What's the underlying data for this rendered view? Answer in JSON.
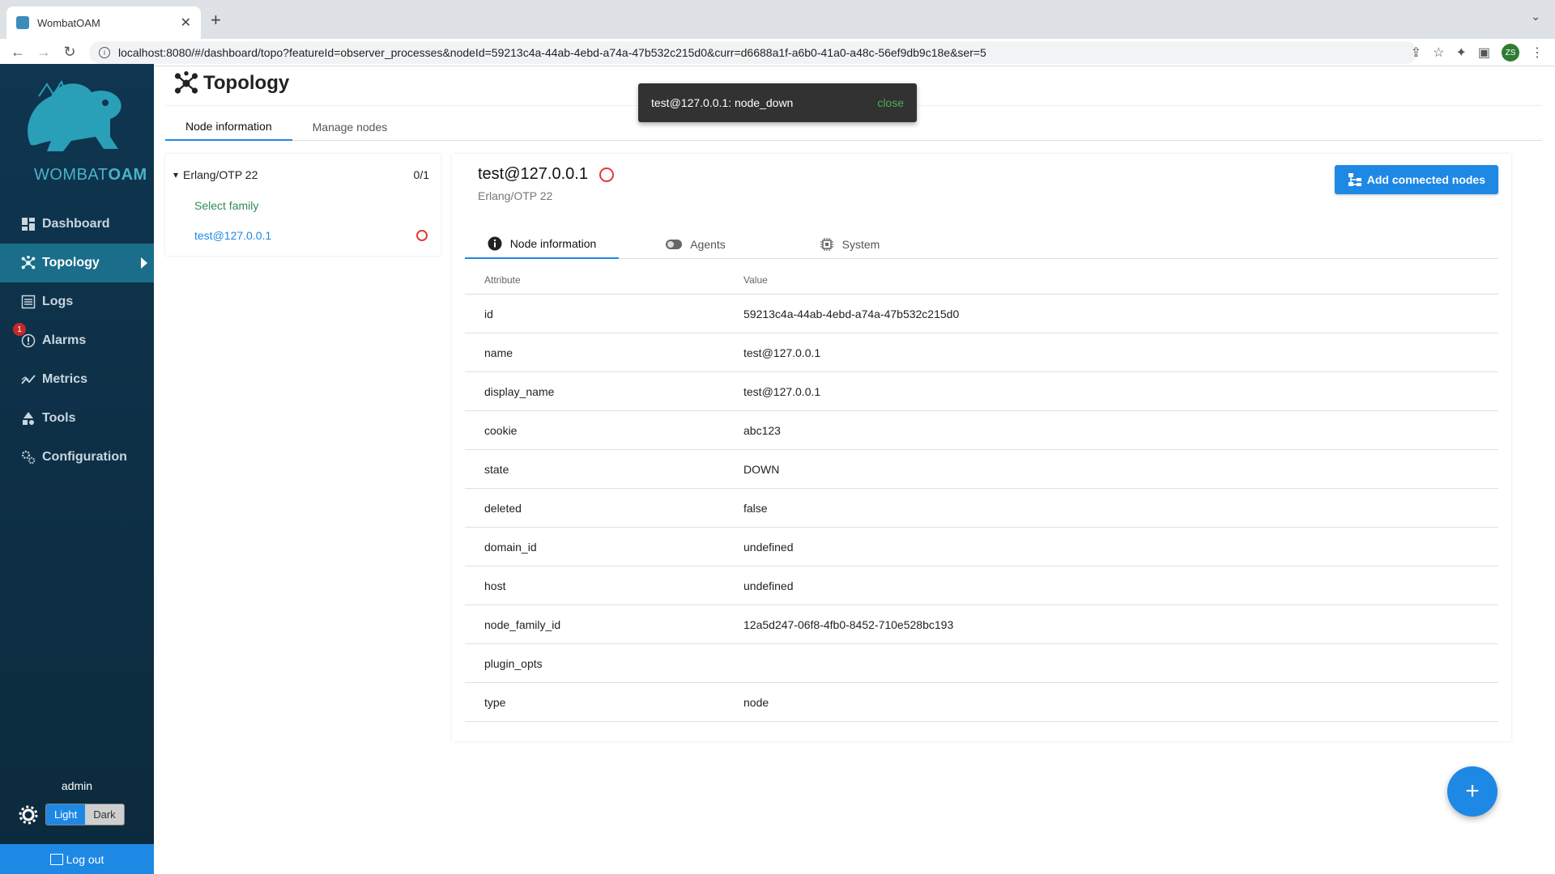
{
  "browser": {
    "tab_title": "WombatOAM",
    "url": "localhost:8080/#/dashboard/topo?featureId=observer_processes&nodeId=59213c4a-44ab-4ebd-a74a-47b532c215d0&curr=d6688a1f-a6b0-41a0-a48c-56ef9db9c18e&ser=5",
    "profile_initials": "ZS"
  },
  "sidebar": {
    "logo_text_light": "WOMBAT",
    "logo_text_bold": "OAM",
    "items": [
      {
        "label": "Dashboard",
        "icon": "dashboard-icon"
      },
      {
        "label": "Topology",
        "icon": "topology-icon",
        "active": true
      },
      {
        "label": "Logs",
        "icon": "logs-icon"
      },
      {
        "label": "Alarms",
        "icon": "alarm-icon",
        "badge": "1"
      },
      {
        "label": "Metrics",
        "icon": "metrics-icon"
      },
      {
        "label": "Tools",
        "icon": "tools-icon"
      },
      {
        "label": "Configuration",
        "icon": "configuration-icon"
      }
    ],
    "user": "admin",
    "theme_light": "Light",
    "theme_dark": "Dark",
    "logout": "Log out"
  },
  "page": {
    "title": "Topology",
    "tabs": [
      "Node information",
      "Manage nodes"
    ]
  },
  "tree": {
    "family": "Erlang/OTP 22",
    "count": "0/1",
    "select_family": "Select family",
    "node": "test@127.0.0.1"
  },
  "detail": {
    "node_name": "test@127.0.0.1",
    "family": "Erlang/OTP 22",
    "add_button": "Add connected nodes",
    "tabs": [
      "Node information",
      "Agents",
      "System"
    ],
    "table_headers": {
      "attribute": "Attribute",
      "value": "Value"
    },
    "rows": [
      {
        "attr": "id",
        "value": "59213c4a-44ab-4ebd-a74a-47b532c215d0"
      },
      {
        "attr": "name",
        "value": "test@127.0.0.1"
      },
      {
        "attr": "display_name",
        "value": "test@127.0.0.1"
      },
      {
        "attr": "cookie",
        "value": "abc123"
      },
      {
        "attr": "state",
        "value": "DOWN"
      },
      {
        "attr": "deleted",
        "value": "false"
      },
      {
        "attr": "domain_id",
        "value": "undefined"
      },
      {
        "attr": "host",
        "value": "undefined"
      },
      {
        "attr": "node_family_id",
        "value": "12a5d247-06f8-4fb0-8452-710e528bc193"
      },
      {
        "attr": "plugin_opts",
        "value": ""
      },
      {
        "attr": "type",
        "value": "node"
      }
    ]
  },
  "snackbar": {
    "message": "test@127.0.0.1: node_down",
    "action": "close"
  },
  "fab": {
    "label": "+"
  },
  "colors": {
    "accent": "#1e88e5",
    "sidebar_bg": "#0f3550",
    "active_nav": "#1a6e8a",
    "status_down": "#e53935",
    "select_family": "#2e8b57"
  }
}
